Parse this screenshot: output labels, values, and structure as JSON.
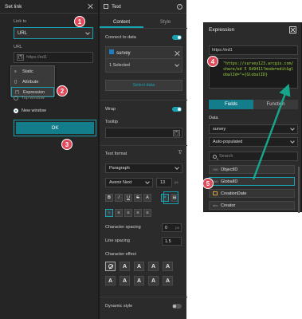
{
  "set_link": {
    "title": "Set link",
    "link_to_label": "Link to",
    "link_to_value": "URL",
    "url_label": "URL",
    "url_value": "https://ed1",
    "url_brace": "{*}",
    "dropdown_items": [
      {
        "icon": "≡",
        "label": "Static"
      },
      {
        "icon": "{}",
        "label": "Attribute"
      },
      {
        "icon": "{*}",
        "label": "Expression"
      }
    ],
    "top_window": "Top window",
    "new_window": "New window",
    "ok_label": "OK"
  },
  "badges": [
    "1",
    "2",
    "3",
    "4",
    "5"
  ],
  "text_panel": {
    "title": "Text",
    "help": "?",
    "tabs": [
      "Content",
      "Style"
    ],
    "connect_label": "Connect to data",
    "data_source": "survey",
    "selected": "1 Selected",
    "select_data": "Select data",
    "wrap_label": "Wrap",
    "tooltip_label": "Tooltip",
    "tooltip_brace": "{*}",
    "text_format_label": "Text format",
    "paragraph": "Paragraph",
    "font": "Avenir Next",
    "font_size": "13",
    "px": "px",
    "format_buttons": [
      "B",
      "I",
      "U",
      "S",
      "A",
      "⚭",
      "▤"
    ],
    "align_buttons": [
      "≡",
      "≡",
      "≡",
      "≡",
      "≡"
    ],
    "char_spacing_label": "Character spacing",
    "char_spacing": "0",
    "line_spacing_label": "Line spacing",
    "line_spacing": "1.5",
    "char_effect_label": "Character effect",
    "effects": [
      "A",
      "A",
      "A",
      "A",
      "A",
      "A",
      "A",
      "A",
      "A",
      "A"
    ],
    "dynamic_style_label": "Dynamic style"
  },
  "expression": {
    "title": "Expression",
    "url": "https://ed1",
    "code": "\"https://survey123.arcgis.com/share/ed                    5 6d9411?mode=edit&globalId=\"+{GlobalID}",
    "tabs": [
      "Fields",
      "Function"
    ],
    "data_label": "Data",
    "data_value": "survey",
    "populate_value": "Auto-populated",
    "search_placeholder": "Search",
    "fields": [
      {
        "type": "OID",
        "name": "ObjectID"
      },
      {
        "type": "GID",
        "name": "GlobalID"
      },
      {
        "type": "date",
        "name": "CreationDate"
      },
      {
        "type": "abc",
        "name": "Creator"
      }
    ]
  },
  "colors": {
    "accent": "#18a1b0",
    "badge": "#e04a5a",
    "arrow": "#16a58a",
    "code": "#9bd23a"
  }
}
